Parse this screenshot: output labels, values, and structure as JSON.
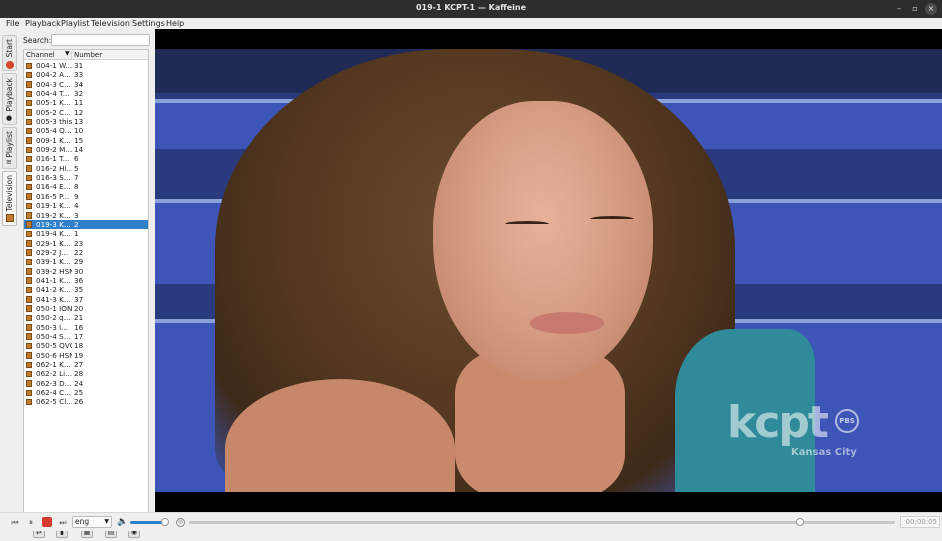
{
  "window": {
    "title": "019-1 KCPT-1 — Kaffeine"
  },
  "menu": [
    {
      "label": "File"
    },
    {
      "label": "Playback"
    },
    {
      "label": "Playlist"
    },
    {
      "label": "Television"
    },
    {
      "label": "Settings"
    },
    {
      "label": "Help"
    }
  ],
  "side_tabs": [
    {
      "label": "Start",
      "icon": "start-icon"
    },
    {
      "label": "Playback",
      "icon": "play-icon"
    },
    {
      "label": "Playlist",
      "icon": "playlist-icon"
    },
    {
      "label": "Television",
      "icon": "tv-icon",
      "active": true
    }
  ],
  "search": {
    "label": "Search:",
    "value": "",
    "placeholder": ""
  },
  "channel_list": {
    "columns": [
      "Channel",
      "Number"
    ],
    "sort_indicator": "▼",
    "selected_index": 17,
    "rows": [
      {
        "name": "004-1 W...",
        "number": "31"
      },
      {
        "name": "004-2 A...",
        "number": "33"
      },
      {
        "name": "004-3 C...",
        "number": "34"
      },
      {
        "name": "004-4 T...",
        "number": "32"
      },
      {
        "name": "005-1 K...",
        "number": "11"
      },
      {
        "name": "005-2 C...",
        "number": "12"
      },
      {
        "name": "005-3 this",
        "number": "13"
      },
      {
        "name": "005-4 Q...",
        "number": "10"
      },
      {
        "name": "009-1 K...",
        "number": "15"
      },
      {
        "name": "009-2 M...",
        "number": "14"
      },
      {
        "name": "016-1 T...",
        "number": "6"
      },
      {
        "name": "016-2 Hi...",
        "number": "5"
      },
      {
        "name": "016-3 S...",
        "number": "7"
      },
      {
        "name": "016-4 E...",
        "number": "8"
      },
      {
        "name": "016-5 P...",
        "number": "9"
      },
      {
        "name": "019-1 K...",
        "number": "4"
      },
      {
        "name": "019-2 K...",
        "number": "3"
      },
      {
        "name": "019-3 K...",
        "number": "2"
      },
      {
        "name": "019-4 K...",
        "number": "1"
      },
      {
        "name": "029-1 K...",
        "number": "23"
      },
      {
        "name": "029-2 J...",
        "number": "22"
      },
      {
        "name": "039-1 K...",
        "number": "29"
      },
      {
        "name": "039-2 HSN",
        "number": "30"
      },
      {
        "name": "041-1 K...",
        "number": "36"
      },
      {
        "name": "041-2 K...",
        "number": "35"
      },
      {
        "name": "041-3 K...",
        "number": "37"
      },
      {
        "name": "050-1 ION",
        "number": "20"
      },
      {
        "name": "050-2 q...",
        "number": "21"
      },
      {
        "name": "050-3 l...",
        "number": "16"
      },
      {
        "name": "050-4 S...",
        "number": "17"
      },
      {
        "name": "050-5 QVC",
        "number": "18"
      },
      {
        "name": "050-6 HSN",
        "number": "19"
      },
      {
        "name": "062-1 K...",
        "number": "27"
      },
      {
        "name": "062-2 Li...",
        "number": "28"
      },
      {
        "name": "062-3 D...",
        "number": "24"
      },
      {
        "name": "062-4 C...",
        "number": "25"
      },
      {
        "name": "062-5 Cl...",
        "number": "26"
      }
    ]
  },
  "panel_tools": [
    {
      "icon": "configure-icon"
    },
    {
      "icon": "channels-icon"
    },
    {
      "icon": "epg-icon"
    },
    {
      "icon": "schedule-icon"
    },
    {
      "icon": "record-icon"
    }
  ],
  "video": {
    "logo_text": "kcpt",
    "logo_sub": "Kansas City",
    "logo_badge": "PBS"
  },
  "controls": {
    "language": "eng",
    "volume_fraction": 0.92,
    "seek_fraction": 0.865,
    "time": "00:00:05"
  }
}
